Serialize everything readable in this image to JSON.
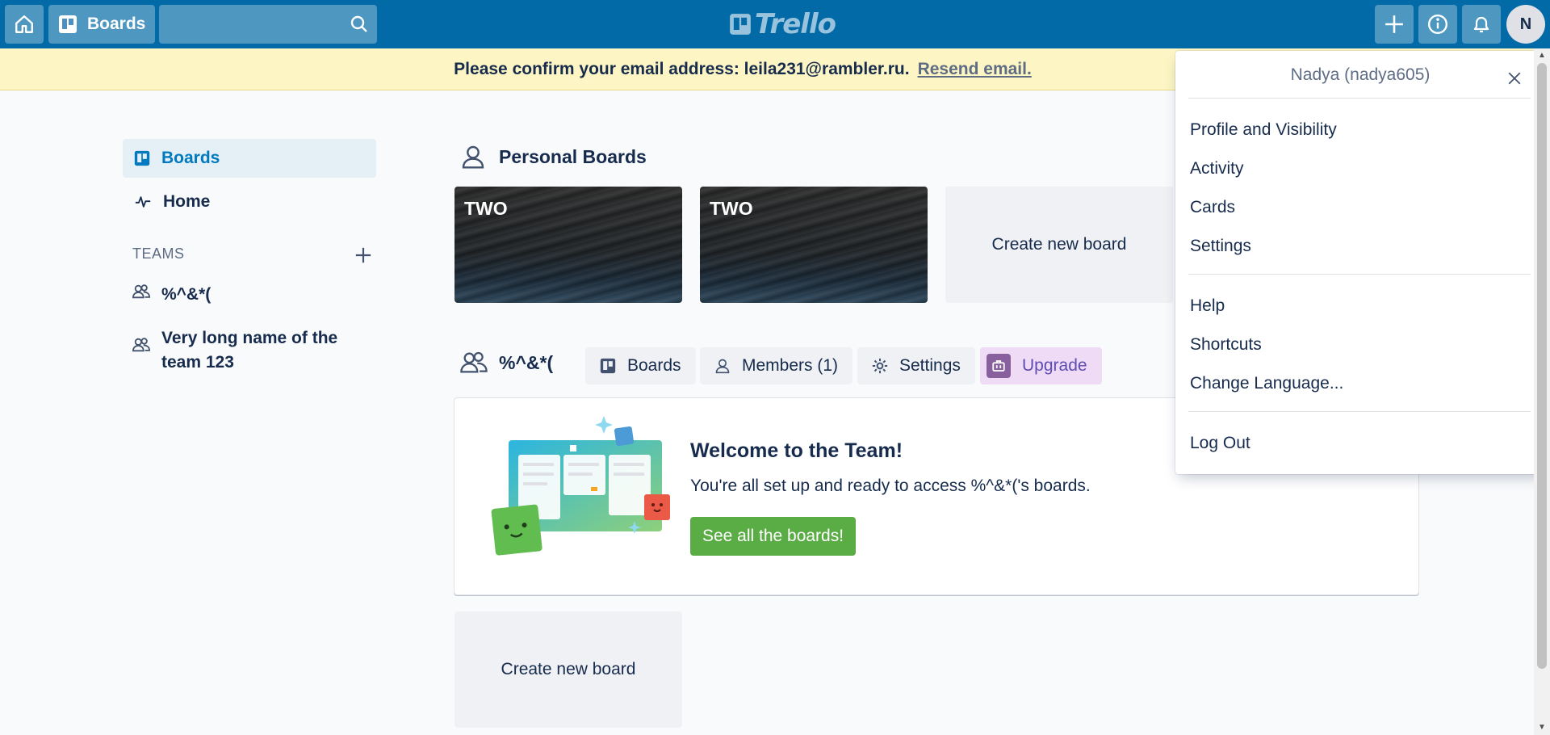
{
  "header": {
    "boards_label": "Boards",
    "search_placeholder": "",
    "logo_text": "Trello",
    "avatar_initial": "N"
  },
  "banner": {
    "message": "Please confirm your email address: leila231@rambler.ru.",
    "link": "Resend email."
  },
  "sidebar": {
    "items": [
      {
        "label": "Boards",
        "icon": "board-icon"
      },
      {
        "label": "Home",
        "icon": "activity-icon"
      }
    ],
    "teams_label": "TEAMS",
    "teams": [
      {
        "label": "%^&*("
      },
      {
        "label": "Very long name of the team 123"
      }
    ]
  },
  "personal": {
    "title": "Personal Boards",
    "boards": [
      {
        "name": "TWO"
      },
      {
        "name": "TWO"
      }
    ],
    "create_label": "Create new board"
  },
  "team_section": {
    "name": "%^&*(",
    "tabs": {
      "boards": "Boards",
      "members": "Members (1)",
      "settings": "Settings",
      "upgrade": "Upgrade"
    },
    "welcome_title": "Welcome to the Team!",
    "welcome_desc": "You're all set up and ready to access %^&*('s boards.",
    "see_button": "See all the boards!",
    "create_label": "Create new board"
  },
  "menu": {
    "title": "Nadya (nadya605)",
    "items_a": [
      "Profile and Visibility",
      "Activity",
      "Cards",
      "Settings"
    ],
    "items_b": [
      "Help",
      "Shortcuts",
      "Change Language..."
    ],
    "items_c": [
      "Log Out"
    ]
  },
  "colors": {
    "header": "#026aa7",
    "banner": "#fdf6c4",
    "accent": "#0079bf",
    "success": "#5aac44",
    "upgrade": "#89609e"
  }
}
